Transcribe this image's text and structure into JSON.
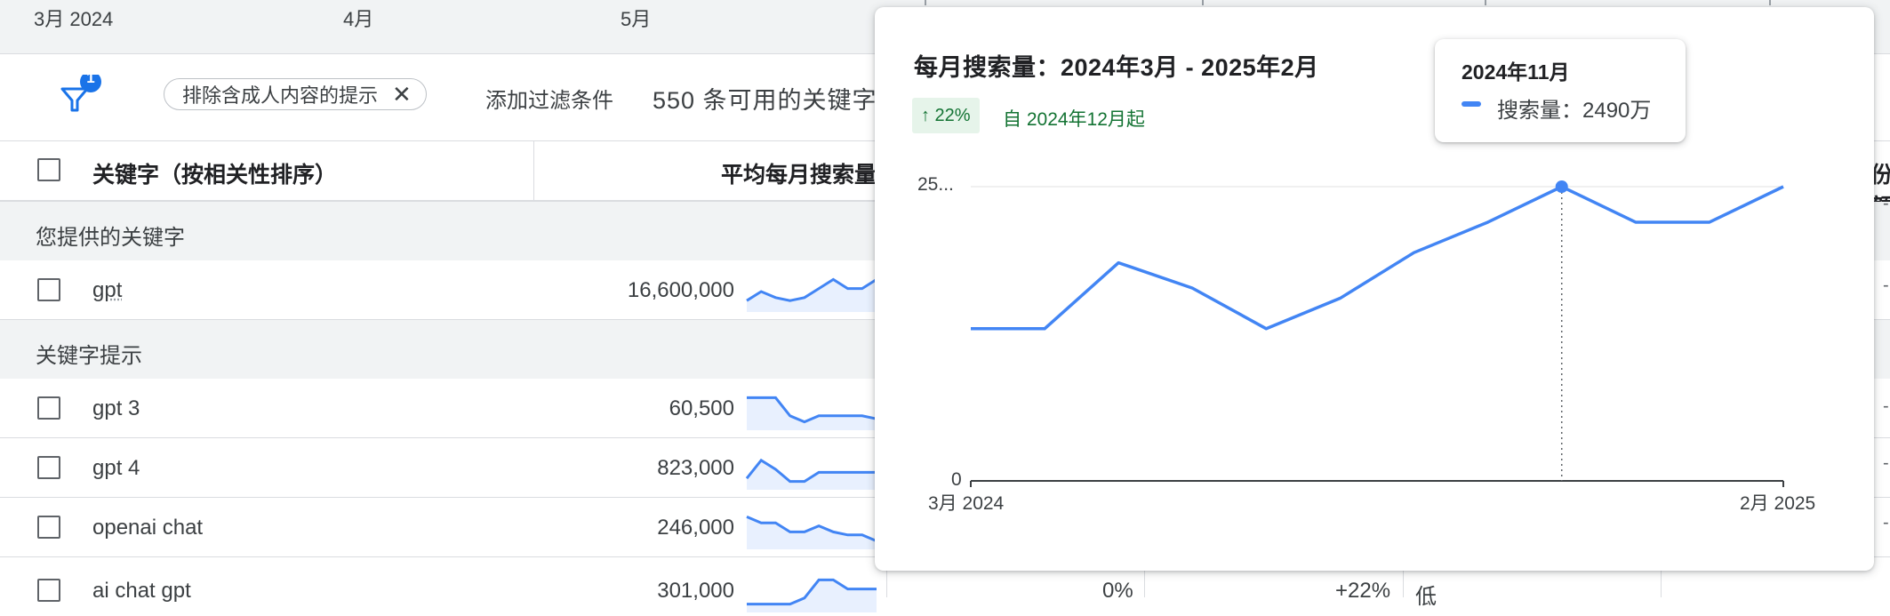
{
  "timeline": {
    "months": [
      "3月 2024",
      "4月",
      "5月"
    ]
  },
  "filter_bar": {
    "filter_count": "1",
    "chip_label": "排除含成人内容的提示",
    "add_filter": "添加过滤条件",
    "available_text": "550 条可用的关键字"
  },
  "table": {
    "header_keyword": "关键字（按相关性排序）",
    "header_avg": "平均每月搜索量",
    "header_far_right": "份额",
    "sections": {
      "provided": "您提供的关键字",
      "suggestions": "关键字提示"
    },
    "rows": [
      {
        "keyword": "gpt",
        "volume": "16,600,000"
      },
      {
        "keyword": "gpt 3",
        "volume": "60,500"
      },
      {
        "keyword": "gpt 4",
        "volume": "823,000"
      },
      {
        "keyword": "openai chat",
        "volume": "246,000"
      },
      {
        "keyword": "ai chat gpt",
        "volume": "301,000",
        "change_3m": "0%",
        "change_yoy": "+22%",
        "competition": "低"
      }
    ]
  },
  "popup": {
    "title": "每月搜索量：2024年3月 - 2025年2月",
    "badge": "↑ 22%",
    "since": "自 2024年12月起",
    "y_top_label": "25...",
    "y_bottom_label": "0",
    "x_start_label": "3月 2024",
    "x_end_label": "2月 2025",
    "tooltip_title": "2024年11月",
    "tooltip_text": "搜索量：2490万",
    "colors": {
      "line": "#4285f4",
      "badge_bg": "#e6f4ea",
      "badge_text": "#137333"
    }
  },
  "chart_data": {
    "type": "line",
    "title": "每月搜索量：2024年3月 - 2025年2月",
    "x": [
      "2024-03",
      "2024-04",
      "2024-05",
      "2024-06",
      "2024-07",
      "2024-08",
      "2024-09",
      "2024-10",
      "2024-11",
      "2024-12",
      "2025-01",
      "2025-02"
    ],
    "series": [
      {
        "name": "搜索量",
        "values": [
          15.0,
          15.0,
          21.5,
          19.0,
          15.0,
          18.0,
          22.5,
          25.5,
          29.0,
          25.5,
          25.5,
          29.0
        ]
      }
    ],
    "unit": "百万",
    "ylim": [
      0,
      29
    ],
    "highlight_index": 8,
    "grid": false
  },
  "sparklines": [
    [
      2,
      5,
      3,
      2,
      3,
      6,
      9,
      6,
      6,
      9
    ],
    [
      9,
      9,
      9,
      3,
      1,
      3,
      3,
      3,
      3,
      2
    ],
    [
      2,
      8,
      5,
      1,
      1,
      4,
      4,
      4,
      4,
      4
    ],
    [
      9,
      7,
      7,
      4,
      4,
      6,
      4,
      3,
      3,
      1
    ],
    [
      1,
      1,
      1,
      1,
      3,
      9,
      9,
      6,
      6,
      6
    ]
  ]
}
